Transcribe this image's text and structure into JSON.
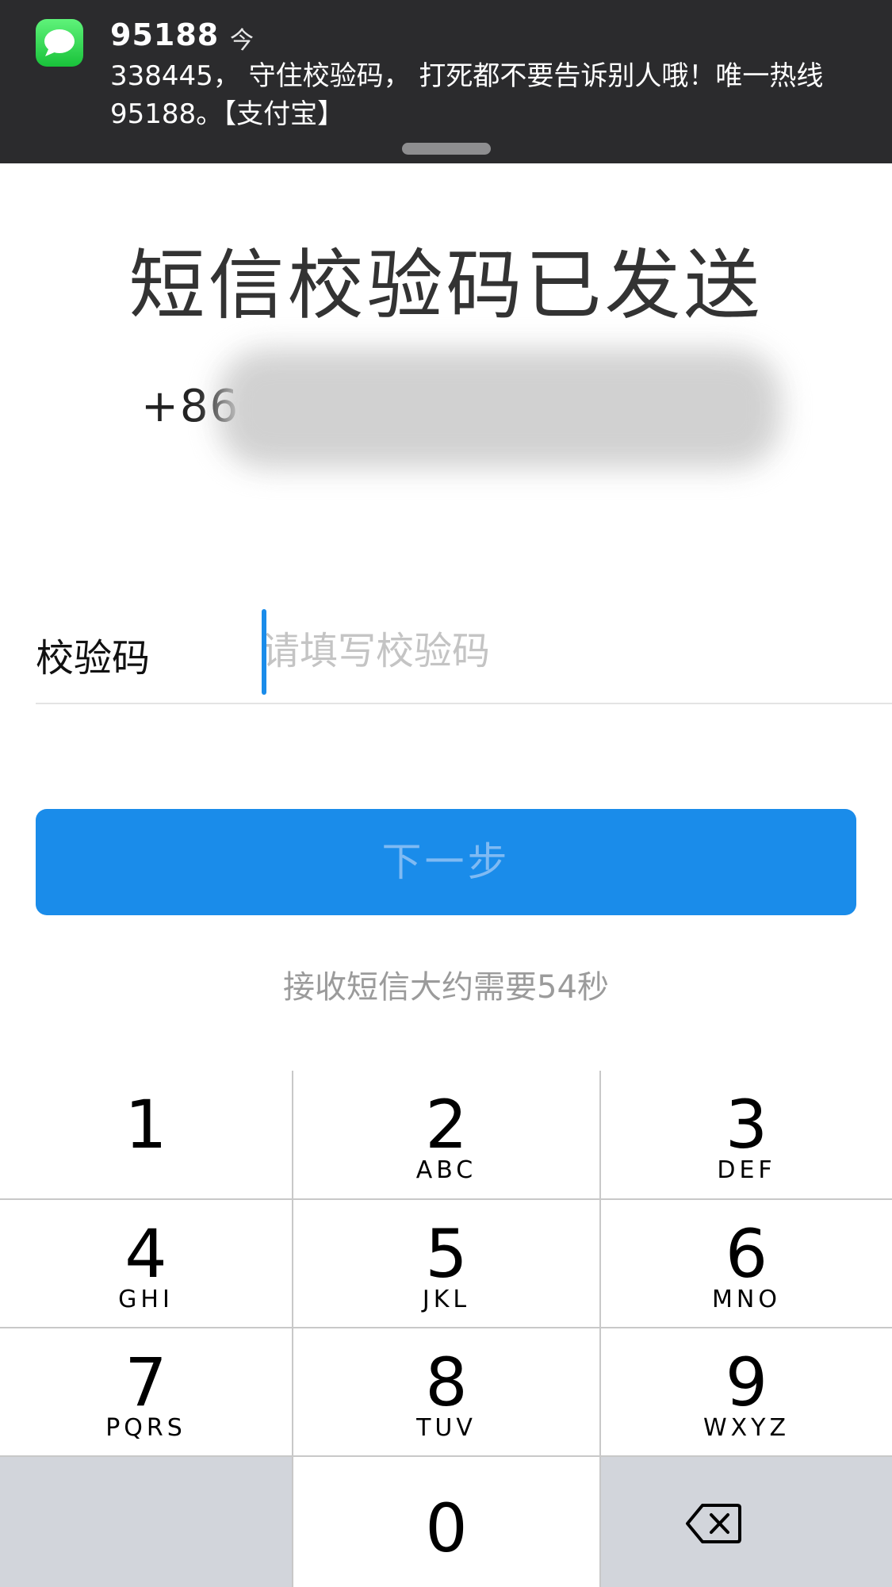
{
  "notification": {
    "app_icon": "messages-bubble-icon",
    "sender": "95188",
    "time": "今",
    "body": "338445，  守住校验码，  打死都不要告诉别人哦！唯一热线95188。【支付宝】"
  },
  "title": "短信校验码已发送",
  "phone": {
    "prefix": "+86",
    "number_obscured": true
  },
  "code_field": {
    "label": "校验码",
    "value": "",
    "placeholder": "请填写校验码"
  },
  "next_button": {
    "label": "下一步",
    "enabled": false
  },
  "hint": "接收短信大约需要54秒",
  "keypad": {
    "keys": [
      {
        "num": "1",
        "letters": ""
      },
      {
        "num": "2",
        "letters": "ABC"
      },
      {
        "num": "3",
        "letters": "DEF"
      },
      {
        "num": "4",
        "letters": "GHI"
      },
      {
        "num": "5",
        "letters": "JKL"
      },
      {
        "num": "6",
        "letters": "MNO"
      },
      {
        "num": "7",
        "letters": "PQRS"
      },
      {
        "num": "8",
        "letters": "TUV"
      },
      {
        "num": "9",
        "letters": "WXYZ"
      },
      {
        "num": "0",
        "letters": ""
      }
    ],
    "backspace_icon": "backspace-icon"
  },
  "colors": {
    "accent": "#1a8cea",
    "banner_bg": "#2b2b2d",
    "key_gray": "#d2d5db"
  }
}
